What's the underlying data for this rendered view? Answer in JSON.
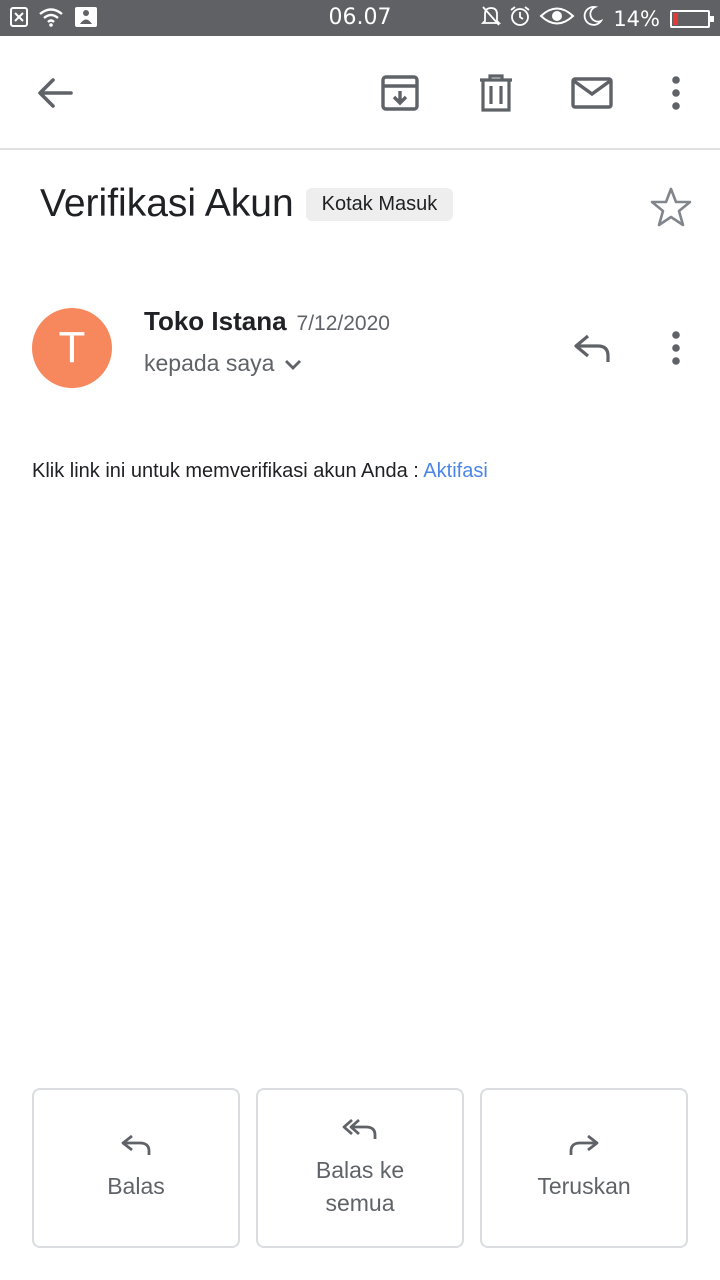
{
  "status_bar": {
    "time": "06.07",
    "battery_percent_text": "14%",
    "battery_level": 0.14,
    "icons": [
      "notification-x-icon",
      "wifi-icon",
      "upload-icon",
      "mute-bell-icon",
      "alarm-icon",
      "eye-icon",
      "moon-icon",
      "battery-icon"
    ]
  },
  "toolbar": {
    "icons": [
      "back-arrow-icon",
      "archive-icon",
      "trash-icon",
      "mail-icon",
      "more-vertical-icon"
    ]
  },
  "email": {
    "subject": "Verifikasi Akun",
    "label": "Kotak Masuk",
    "sender_initial": "T",
    "sender_name": "Toko Istana",
    "date": "7/12/2020",
    "recipient": "kepada saya",
    "body_text": "Klik link ini untuk memverifikasi akun Anda : ",
    "body_link": "Aktifasi"
  },
  "actions": {
    "reply": "Balas",
    "reply_all": "Balas ke semua",
    "forward": "Teruskan"
  },
  "colors": {
    "status_bar": "#5f6164",
    "avatar": "#f7875c",
    "link": "#4a86e8",
    "battery_low": "#e53935"
  }
}
